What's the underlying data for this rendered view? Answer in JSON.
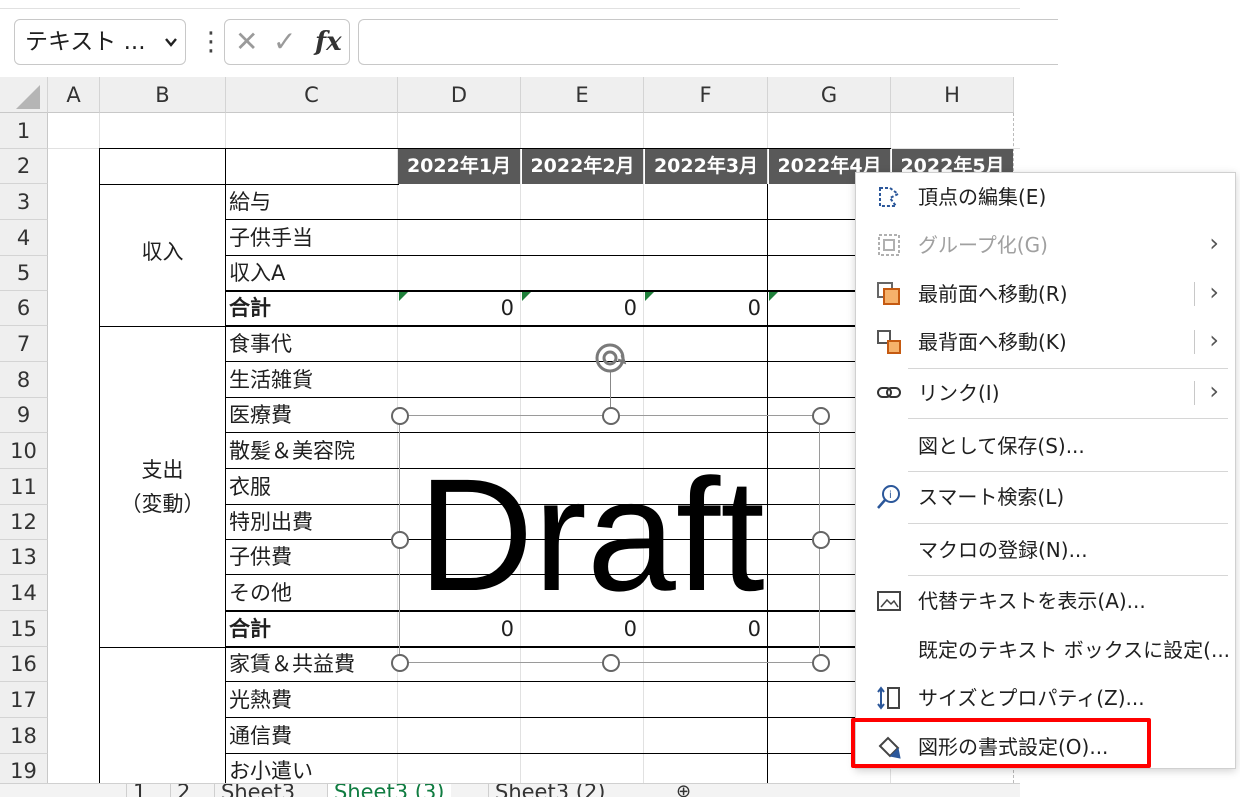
{
  "formula_bar": {
    "name_box": "テキスト ...",
    "more_icon": "vertical-dots-icon",
    "cancel_glyph": "✕",
    "enter_glyph": "✓",
    "fx_label": "fx",
    "formula_value": ""
  },
  "columns": [
    "A",
    "B",
    "C",
    "D",
    "E",
    "F",
    "G",
    "H"
  ],
  "rows": [
    "1",
    "2",
    "3",
    "4",
    "5",
    "6",
    "7",
    "8",
    "9",
    "10",
    "11",
    "12",
    "13",
    "14",
    "15",
    "16",
    "17",
    "18",
    "19"
  ],
  "months": [
    "2022年1月",
    "2022年2月",
    "2022年3月",
    "2022年4月",
    "2022年5月"
  ],
  "groups": {
    "income": "収入",
    "expense_line1": "支出",
    "expense_line2": "（変動）"
  },
  "items": [
    "給与",
    "子供手当",
    "収入A",
    "合計",
    "食事代",
    "生活雑貨",
    "医療費",
    "散髪＆美容院",
    "衣服",
    "特別出費",
    "子供費",
    "その他",
    "合計",
    "家賃＆共益費",
    "光熱費",
    "通信費",
    "お小遣い"
  ],
  "totals": {
    "row6": [
      "0",
      "0",
      "0"
    ],
    "row15": [
      "0",
      "0",
      "0"
    ]
  },
  "shape": {
    "text": "Draft"
  },
  "tabs": [
    "1",
    "2",
    "Sheet3",
    "Sheet3 (3)",
    "Sheet3 (2)"
  ],
  "active_tab": "Sheet3 (3)",
  "context_menu": [
    {
      "label": "頂点の編集(E)",
      "icon": "edit-points-icon"
    },
    {
      "label": "グループ化(G)",
      "icon": "group-icon",
      "disabled": true
    },
    {
      "label": "最前面へ移動(R)",
      "icon": "bring-to-front-icon"
    },
    {
      "label": "最背面へ移動(K)",
      "icon": "send-to-back-icon"
    },
    {
      "label": "リンク(I)",
      "icon": "link-icon"
    },
    {
      "label": "図として保存(S)...",
      "icon": ""
    },
    {
      "label": "スマート検索(L)",
      "icon": "smart-lookup-icon"
    },
    {
      "label": "マクロの登録(N)...",
      "icon": ""
    },
    {
      "label": "代替テキストを表示(A)...",
      "icon": "alt-text-icon"
    },
    {
      "label": "既定のテキスト ボックスに設定(...",
      "icon": ""
    },
    {
      "label": "サイズとプロパティ(Z)...",
      "icon": "size-properties-icon"
    },
    {
      "label": "図形の書式設定(O)...",
      "icon": "format-shape-icon"
    }
  ],
  "colors": {
    "highlight": "#ff0000",
    "header_fill": "#595959",
    "active_tab": "#107c41"
  }
}
